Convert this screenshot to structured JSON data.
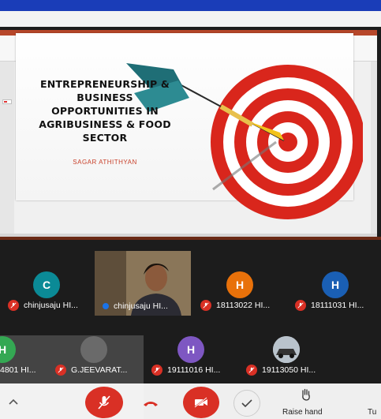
{
  "slide": {
    "title_lines": [
      "ENTREPRENEURSHIP &",
      "BUSINESS",
      "OPPORTUNITIES IN",
      "AGRIBUSINESS & FOOD",
      "SECTOR"
    ],
    "author": "SAGAR ATHITHYAN"
  },
  "participants": [
    {
      "initial": "C",
      "name": "chinjusaju HI...",
      "color": "#0b8a96"
    },
    {
      "initial": "",
      "name": "chinjusaju HI...",
      "color": ""
    },
    {
      "initial": "H",
      "name": "18113022 HI...",
      "color": "#e8710a"
    },
    {
      "initial": "H",
      "name": "18111031 HI...",
      "color": "#1a5fb4"
    },
    {
      "initial": "H",
      "name": "4801 HI...",
      "color": "#34a853"
    },
    {
      "initial": "",
      "name": "G.JEEVARAT...",
      "color": ""
    },
    {
      "initial": "H",
      "name": "19111016 HI...",
      "color": "#7e57c2"
    },
    {
      "initial": "",
      "name": "19113050 HI...",
      "color": ""
    }
  ],
  "controls": {
    "raise_hand": "Raise hand",
    "more": "Tu"
  },
  "colors": {
    "mic_off": "#d93025",
    "meet_background": "#1c1c1c",
    "accent": "#1a3db8"
  },
  "icons": [
    "mic-off-icon",
    "hangup-icon",
    "camera-off-icon",
    "check-icon",
    "raise-hand-icon",
    "chevron-up-icon",
    "dart-target-icon"
  ]
}
